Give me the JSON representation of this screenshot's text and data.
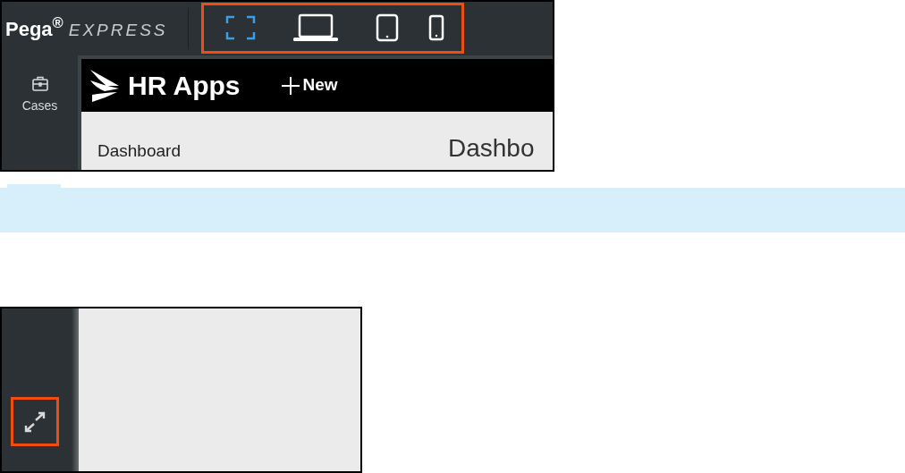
{
  "top_screenshot": {
    "header": {
      "brand": "Pega$^{®}$",
      "product": "EXPRESS"
    },
    "device_modes": [
      {
        "kind": "fullscreen",
        "selected": true
      },
      {
        "kind": "laptop",
        "selected": false
      },
      {
        "kind": "tablet",
        "selected": false
      },
      {
        "kind": "phone",
        "selected": false
      }
    ],
    "rail": {
      "items": [
        {
          "label": "Cases"
        }
      ]
    },
    "app_header": {
      "title": "HR Apps",
      "new_button": "New"
    },
    "nav": {
      "items": [
        "Dashboard"
      ]
    },
    "page_heading": "Dashbo"
  }
}
